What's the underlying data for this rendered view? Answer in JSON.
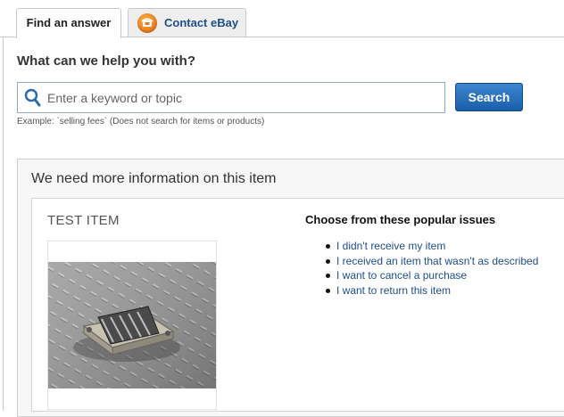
{
  "tabs": {
    "find": "Find an answer",
    "contact": "Contact eBay"
  },
  "search": {
    "heading": "What can we help you with?",
    "placeholder": "Enter a keyword or topic",
    "button": "Search",
    "example": "Example: `selling fees` (Does not search for items or products)"
  },
  "info": {
    "title": "We need more information on this item",
    "item_title": "TEST ITEM",
    "issues_title": "Choose from these popular issues",
    "issues": [
      "I didn't receive my item",
      "I received an item that wasn't as described",
      "I want to cancel a purchase",
      "I want to return this item"
    ]
  },
  "colors": {
    "accent": "#1f4e8c",
    "button": "#1a5ea8",
    "contact_icon": "#e8771a"
  },
  "icons": [
    "phone-icon",
    "search-icon"
  ]
}
